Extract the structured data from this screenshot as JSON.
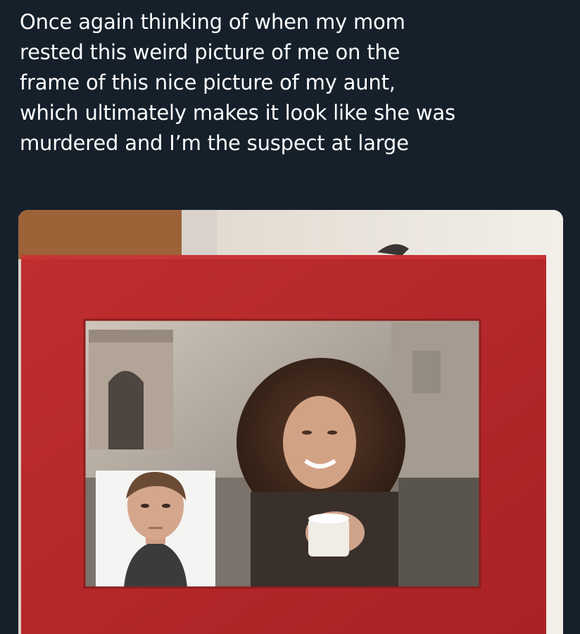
{
  "post": {
    "text": "Once again thinking of when my mom\nrested this weird picture of me on the\nframe of this nice picture of my aunt,\nwhich ultimately makes it look like she was\nmurdered and I’m the suspect at large"
  },
  "colors": {
    "background": "#15202b",
    "text": "#ffffff",
    "frame_red": "#b8292b"
  }
}
